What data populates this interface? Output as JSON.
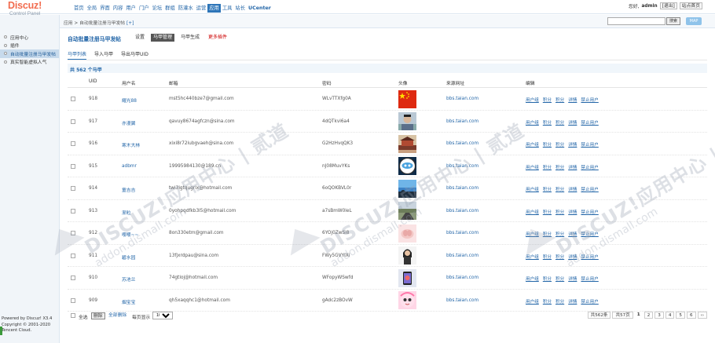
{
  "logo": {
    "brand": "Discuz!",
    "subtitle": "Control Panel"
  },
  "nav": {
    "items": [
      "首页",
      "全局",
      "界面",
      "内容",
      "用户",
      "门户",
      "论坛",
      "群组",
      "防灌水",
      "运营",
      "应用",
      "工具",
      "站长",
      "UCenter"
    ],
    "active_index": 10
  },
  "topright": {
    "greeting": "您好,",
    "user": "admin",
    "logout": "[退出]",
    "home": "站点首页"
  },
  "breadcrumb": {
    "text": "应用 > 自动批量注册马甲发帖",
    "collapse": "[+]"
  },
  "search": {
    "placeholder": "",
    "button": "搜索",
    "map": "MAP"
  },
  "sidebar": {
    "items": [
      "应用中心",
      "插件",
      "自动批量注册马甲发帖",
      "真实智能虚拟人气"
    ],
    "active_index": 2,
    "footer": [
      "Powered by Discuz! X3.4",
      "Copyright © 2001-2020",
      "Tencent Cloud."
    ]
  },
  "page": {
    "title": "自动批量注册马甲发帖",
    "tabs": [
      "设置",
      "马甲管理",
      "马甲生成",
      "更多插件"
    ],
    "active_tab": 1,
    "subtabs": [
      "马甲列表",
      "导入马甲",
      "导出马甲UID"
    ],
    "active_subtab": 0,
    "count_text": "共 562 个马甲"
  },
  "table": {
    "headers": [
      "UID",
      "用户名",
      "邮箱",
      "密码",
      "头像",
      "来源网址",
      "编辑"
    ],
    "actions": [
      "用户组",
      "积分",
      "积分",
      "详情",
      "禁止用户"
    ],
    "rows": [
      {
        "uid": "918",
        "username": "耀光88",
        "email": "mst5hc440bze7@gmail.com",
        "password": "WLvTTXfg0A",
        "source": "bbs.taian.com",
        "avatar": "flag"
      },
      {
        "uid": "917",
        "username": "亦漫翼",
        "email": "qavuy8674agfczn@sina.com",
        "password": "4dQTkvi6a4",
        "source": "bbs.taian.com",
        "avatar": "person"
      },
      {
        "uid": "916",
        "username": "寒木大林",
        "email": "xixi8r72iubgvaeh@sina.com",
        "password": "G2HzHvqQK3",
        "source": "bbs.taian.com",
        "avatar": "building"
      },
      {
        "uid": "915",
        "username": "adbmr",
        "email": "19995984130@189.cn",
        "password": "nJ08MuvYKs",
        "source": "bbs.taian.com",
        "avatar": "cartoon"
      },
      {
        "uid": "914",
        "username": "童吉吉",
        "email": "twi3igtqugrix@hotmail.com",
        "password": "6oQOKBVL0r",
        "source": "bbs.taian.com",
        "avatar": "sky"
      },
      {
        "uid": "913",
        "username": "渐粒",
        "email": "0yohpqdfkb3l5@hotmail.com",
        "password": "a7sBmW0leL",
        "source": "bbs.taian.com",
        "avatar": "road"
      },
      {
        "uid": "912",
        "username": "嘤嘤~~",
        "email": "8on330etm@gmail.com",
        "password": "6YOj0ZwSi8",
        "source": "bbs.taian.com",
        "avatar": "hands"
      },
      {
        "uid": "911",
        "username": "碧水园",
        "email": "13fjxrdpau@sina.com",
        "password": "FWy5GVYIXi",
        "source": "bbs.taian.com",
        "avatar": "girl"
      },
      {
        "uid": "910",
        "username": "苏池兰",
        "email": "74gtloj@hotmail.com",
        "password": "WFopyWSwfd",
        "source": "bbs.taian.com",
        "avatar": "phone"
      },
      {
        "uid": "909",
        "username": "烟宝宝",
        "email": "qh5xaqqhc1@hotmail.com",
        "password": "gAdc2zBOvW",
        "source": "bbs.taian.com",
        "avatar": "anime"
      }
    ]
  },
  "footer": {
    "select_all": "全选",
    "delete": "删除",
    "clear_all": "全部删除",
    "per_page_label": "每页显示",
    "per_page_value": "10",
    "pager": [
      "共562条",
      "共57页",
      "1",
      "2",
      "3",
      "4",
      "5",
      "6",
      "››"
    ]
  },
  "watermark": {
    "brand": "DISCUZ!应用中心 | 贰道",
    "site": "addon.dismall.com"
  },
  "colors": {
    "accent": "#2d75b8",
    "logo": "#f26c4f",
    "link": "#2366a8",
    "danger": "#cc0000"
  }
}
